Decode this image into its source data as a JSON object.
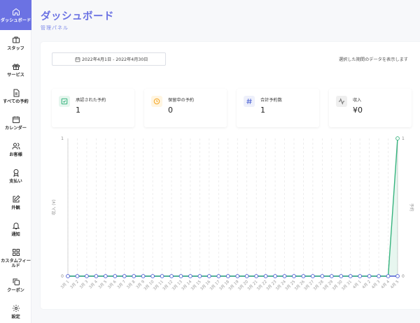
{
  "header": {
    "title": "ダッシュボード",
    "subtitle": "管理パネル"
  },
  "sidebar": {
    "items": [
      {
        "label": "ダッシュボード",
        "icon": "home-icon",
        "active": true
      },
      {
        "label": "スタッフ",
        "icon": "briefcase-icon"
      },
      {
        "label": "サービス",
        "icon": "gift-icon"
      },
      {
        "label": "すべての予約",
        "icon": "document-icon"
      },
      {
        "label": "カレンダー",
        "icon": "calendar-icon"
      },
      {
        "label": "お客様",
        "icon": "users-icon"
      },
      {
        "label": "支払い",
        "icon": "award-icon"
      },
      {
        "label": "外観",
        "icon": "edit-icon"
      },
      {
        "label": "通知",
        "icon": "bell-icon"
      },
      {
        "label": "カスタムフィールド",
        "icon": "grid-icon"
      },
      {
        "label": "クーポン",
        "icon": "copy-icon"
      },
      {
        "label": "設定",
        "icon": "gear-icon"
      }
    ]
  },
  "filter": {
    "date_range": "2022年4月1日 - 2022年4月30日",
    "hint": "選択した期間のデータを表示します"
  },
  "stats": [
    {
      "label": "承認された予約",
      "value": "1",
      "icon": "check-square-icon",
      "color": "#36b37e",
      "bg": "#e6f6ee"
    },
    {
      "label": "保留中の予約",
      "value": "0",
      "icon": "clock-icon",
      "color": "#f5a623",
      "bg": "#fff5e1"
    },
    {
      "label": "合計予約数",
      "value": "1",
      "icon": "hash-icon",
      "color": "#5a6fd6",
      "bg": "#eef0fb"
    },
    {
      "label": "収入",
      "value": "¥0",
      "icon": "activity-icon",
      "color": "#777777",
      "bg": "#efefef"
    }
  ],
  "chart_data": {
    "type": "line",
    "ylabel_left": "収入 (¥)",
    "ylabel_right": "予約",
    "ylim": [
      0,
      1
    ],
    "y_ticks": [
      "0",
      "1"
    ],
    "grid": true,
    "x": [
      "3月 1",
      "3月 2",
      "3月 3",
      "3月 4",
      "3月 5",
      "3月 6",
      "3月 7",
      "3月 8",
      "3月 9",
      "3月 10",
      "3月 11",
      "3月 12",
      "3月 13",
      "3月 14",
      "3月 15",
      "3月 16",
      "3月 17",
      "3月 18",
      "3月 19",
      "3月 20",
      "3月 21",
      "3月 22",
      "3月 23",
      "3月 24",
      "3月 25",
      "3月 26",
      "3月 27",
      "3月 28",
      "3月 29",
      "3月 30",
      "3月 31",
      "4月 1",
      "4月 2",
      "4月 3",
      "4月 4",
      "4月 5"
    ],
    "series": [
      {
        "name": "",
        "axis": "left",
        "color": "#4a5bd4",
        "values": [
          0,
          0,
          0,
          0,
          0,
          0,
          0,
          0,
          0,
          0,
          0,
          0,
          0,
          0,
          0,
          0,
          0,
          0,
          0,
          0,
          0,
          0,
          0,
          0,
          0,
          0,
          0,
          0,
          0,
          0,
          0,
          0,
          0,
          0,
          0,
          0
        ]
      },
      {
        "name": "",
        "axis": "right",
        "color": "#36b37e",
        "values": [
          0,
          0,
          0,
          0,
          0,
          0,
          0,
          0,
          0,
          0,
          0,
          0,
          0,
          0,
          0,
          0,
          0,
          0,
          0,
          0,
          0,
          0,
          0,
          0,
          0,
          0,
          0,
          0,
          0,
          0,
          0,
          0,
          0,
          0,
          0,
          1
        ]
      }
    ]
  }
}
